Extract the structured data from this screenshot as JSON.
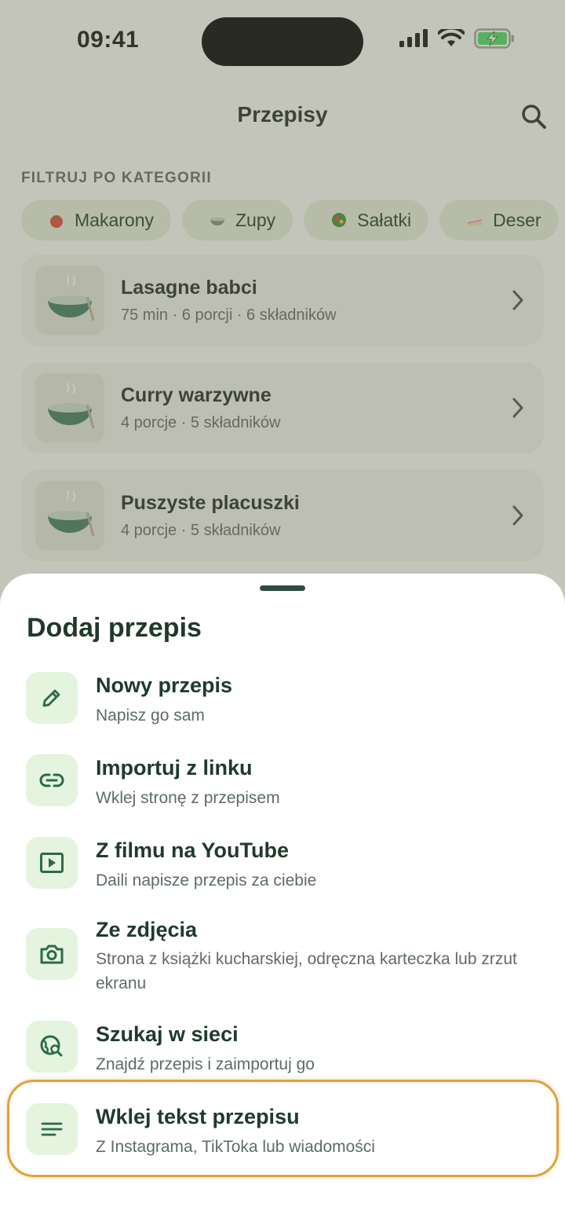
{
  "status_bar": {
    "time": "09:41"
  },
  "header": {
    "title": "Przepisy",
    "search_icon": "search-icon"
  },
  "filter": {
    "label": "FILTRUJ PO KATEGORII",
    "chips": [
      {
        "label": "Makarony",
        "emoji": "tomato"
      },
      {
        "label": "Zupy",
        "emoji": "soup-bowl"
      },
      {
        "label": "Sałatki",
        "emoji": "salad"
      },
      {
        "label": "Deser",
        "emoji": "cake"
      }
    ]
  },
  "recipes": [
    {
      "title": "Lasagne babci",
      "meta": "75 min · 6 porcji · 6 składników"
    },
    {
      "title": "Curry warzywne",
      "meta": "4 porcje · 5 składników"
    },
    {
      "title": "Puszyste placuszki",
      "meta": "4 porcje · 5 składników"
    }
  ],
  "sheet": {
    "title": "Dodaj przepis",
    "options": [
      {
        "title": "Nowy przepis",
        "subtitle": "Napisz go sam",
        "icon": "pencil-icon"
      },
      {
        "title": "Importuj z linku",
        "subtitle": "Wklej stronę z przepisem",
        "icon": "link-icon"
      },
      {
        "title": "Z filmu na YouTube",
        "subtitle": "Daili napisze przepis za ciebie",
        "icon": "play-icon"
      },
      {
        "title": "Ze zdjęcia",
        "subtitle": "Strona z książki kucharskiej, odręczna karteczka lub zrzut ekranu",
        "icon": "camera-icon"
      },
      {
        "title": "Szukaj w sieci",
        "subtitle": "Znajdź przepis i zaimportuj go",
        "icon": "globe-search-icon"
      },
      {
        "title": "Wklej tekst przepisu",
        "subtitle": "Z Instagrama, TikToka lub wiadomości",
        "icon": "text-lines-icon"
      }
    ]
  },
  "colors": {
    "accent": "#2d6a4a",
    "icon_bg": "#e4f4de",
    "highlight": "#e0a23a",
    "battery": "#4cd964"
  }
}
